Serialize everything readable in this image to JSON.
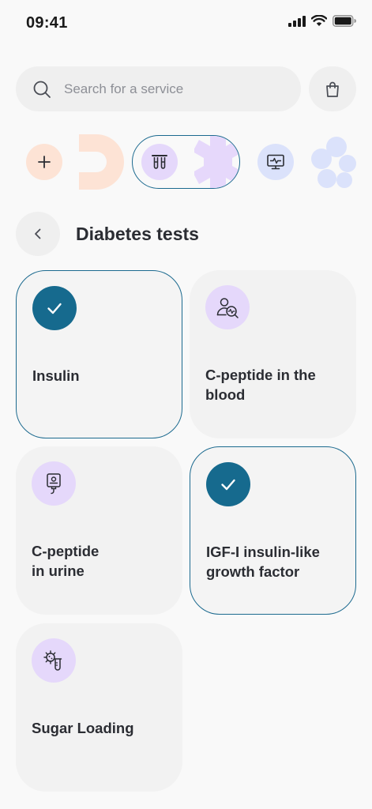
{
  "status_bar": {
    "time": "09:41"
  },
  "search": {
    "placeholder": "Search for a service",
    "value": ""
  },
  "icons": {
    "search": "search-icon",
    "bag": "shopping-bag-icon",
    "back": "chevron-left-icon",
    "check": "check-icon",
    "plus": "plus-icon",
    "test_tubes": "test-tubes-icon",
    "monitor": "heart-monitor-icon",
    "doctor": "person-search-icon",
    "drip": "iv-bag-icon",
    "virus": "microbe-test-icon"
  },
  "colors": {
    "accent": "#166a8e",
    "selected_border": "#1c6a8f",
    "icon_bg_purple": "#e5d8fb",
    "peach": "#fde3d5",
    "lavender": "#e6d8fb",
    "periwinkle": "#dbe2fb"
  },
  "section": {
    "title": "Diabetes tests"
  },
  "tests": [
    {
      "label": "Insulin",
      "selected": true
    },
    {
      "label": "C-peptide in the blood",
      "selected": false
    },
    {
      "label": "C-peptide\nin urine",
      "selected": false
    },
    {
      "label": "IGF-I insulin-like growth factor",
      "selected": true
    },
    {
      "label": "Sugar Loading",
      "selected": false
    }
  ]
}
